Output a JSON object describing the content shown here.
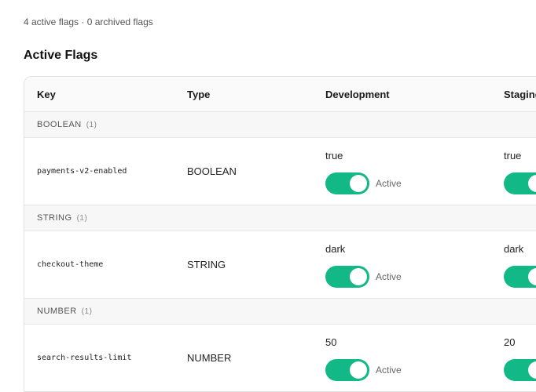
{
  "summary": "4 active flags · 0 archived flags",
  "section_title": "Active Flags",
  "columns": {
    "key": "Key",
    "type": "Type",
    "development": "Development",
    "staging": "Staging"
  },
  "groups": [
    {
      "name": "BOOLEAN",
      "count": "(1)",
      "flag": {
        "key": "payments-v2-enabled",
        "type": "BOOLEAN",
        "dev_value": "true",
        "dev_status": "Active",
        "staging_value": "true"
      }
    },
    {
      "name": "STRING",
      "count": "(1)",
      "flag": {
        "key": "checkout-theme",
        "type": "STRING",
        "dev_value": "dark",
        "dev_status": "Active",
        "staging_value": "dark"
      }
    },
    {
      "name": "NUMBER",
      "count": "(1)",
      "flag": {
        "key": "search-results-limit",
        "type": "NUMBER",
        "dev_value": "50",
        "dev_status": "Active",
        "staging_value": "20"
      }
    }
  ],
  "colors": {
    "toggle_on": "#12b886"
  }
}
